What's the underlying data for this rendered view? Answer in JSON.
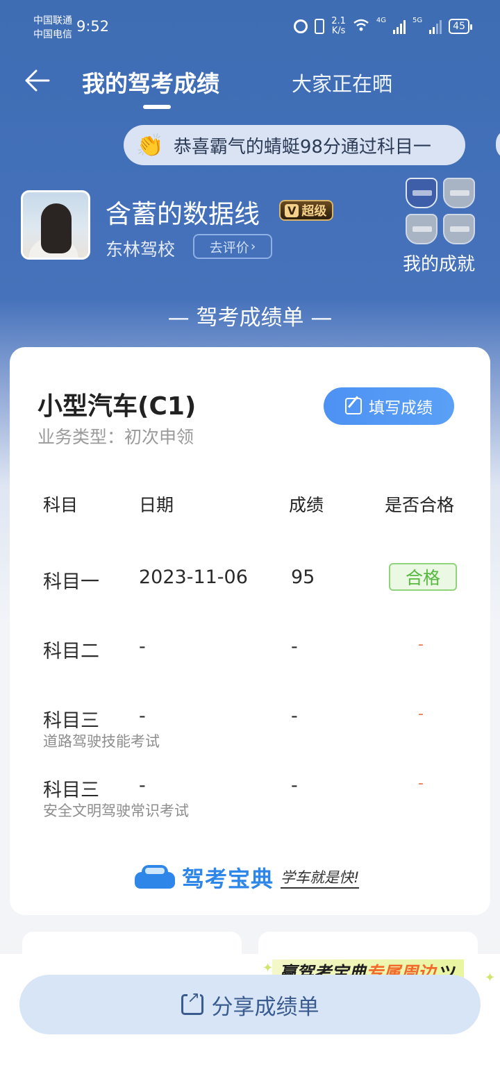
{
  "status_bar": {
    "carrier1": "中国联通",
    "carrier2": "中国电信",
    "time": "9:52",
    "net_speed_value": "2.1",
    "net_speed_unit": "K/s",
    "signal1_label": "4G",
    "signal2_label": "5G",
    "battery": "45"
  },
  "nav": {
    "active_tab": "我的驾考成绩",
    "other_tab": "大家正在晒"
  },
  "congrats": {
    "text": "恭喜霸气的蜻蜓98分通过科目一"
  },
  "profile": {
    "username": "含蓄的数据线",
    "vip_label": "超级",
    "vip_v": "V",
    "school": "东林驾校",
    "rate_button": "去评价",
    "rate_chevron": "›",
    "achievements_label": "我的成就"
  },
  "section_title": "— 驾考成绩单 —",
  "card": {
    "vehicle": "小型汽车(C1)",
    "business_type": "业务类型：初次申领",
    "fill_button": "填写成绩",
    "headers": {
      "subject": "科目",
      "date": "日期",
      "score": "成绩",
      "pass": "是否合格"
    },
    "rows": [
      {
        "subject": "科目一",
        "subtitle": "",
        "date": "2023-11-06",
        "score": "95",
        "pass": "合格"
      },
      {
        "subject": "科目二",
        "subtitle": "",
        "date": "-",
        "score": "-",
        "pass": "-"
      },
      {
        "subject": "科目三",
        "subtitle": "道路驾驶技能考试",
        "date": "-",
        "score": "-",
        "pass": "-"
      },
      {
        "subject": "科目三",
        "subtitle": "安全文明驾驶常识考试",
        "date": "-",
        "score": "-",
        "pass": "-"
      }
    ],
    "brand_name": "驾考宝典",
    "brand_slogan": "学车就是快!"
  },
  "promo": {
    "part1": "赢驾考宝典",
    "part2": "专属周边"
  },
  "share_button": "分享成绩单",
  "colors": {
    "header_blue": "#3e6db4",
    "accent_blue": "#4d92f3",
    "pass_green": "#57b83e",
    "dash_orange": "#f07a45"
  }
}
